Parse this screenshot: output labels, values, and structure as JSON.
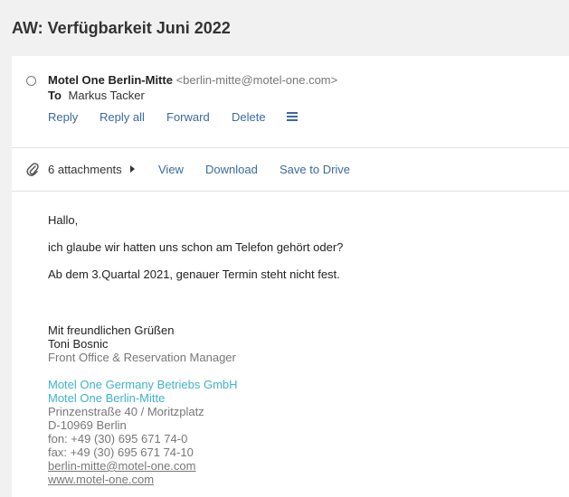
{
  "subject": "AW: Verfügbarkeit Juni 2022",
  "header": {
    "sender_name": "Motel One Berlin-Mitte",
    "sender_email": "<berlin-mitte@motel-one.com>",
    "to_label": "To",
    "to_name": "Markus Tacker"
  },
  "actions": {
    "reply": "Reply",
    "reply_all": "Reply all",
    "forward": "Forward",
    "delete": "Delete",
    "more_icon": "menu-icon"
  },
  "attachments": {
    "count_label": "6 attachments",
    "view": "View",
    "download": "Download",
    "save_to_drive": "Save to Drive"
  },
  "body": {
    "greeting": "Hallo,",
    "line1": "ich glaube wir hatten uns schon am Telefon gehört oder?",
    "line2": "Ab dem 3.Quartal 2021, genauer Termin steht nicht fest."
  },
  "signature": {
    "closing": "Mit freundlichen Grüßen",
    "name": "Toni Bosnic",
    "title": "Front Office & Reservation Manager",
    "company": "Motel One Germany Betriebs GmbH",
    "hotel": "Motel One Berlin-Mitte",
    "street": "Prinzenstraße 40 / Moritzplatz",
    "city": "D-10969 Berlin",
    "phone": "fon: +49 (30) 695 671 74-0",
    "fax": "fax: +49 (30) 695 671 74-10",
    "email": "berlin-mitte@motel-one.com",
    "web": "www.motel-one.com"
  },
  "colors": {
    "link": "#3b6aa0",
    "teal": "#3fb3c8",
    "background": "#f1f1f1"
  }
}
